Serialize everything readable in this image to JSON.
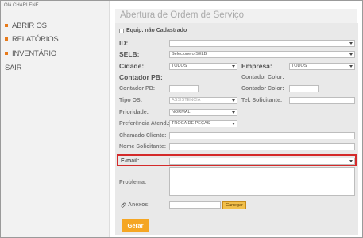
{
  "sidebar": {
    "user": "Olá CHARLENE",
    "items": [
      {
        "label": "ABRIR OS"
      },
      {
        "label": "RELATÓRIOS"
      },
      {
        "label": "INVENTÁRIO"
      },
      {
        "label": "SAIR"
      }
    ]
  },
  "form": {
    "title": "Abertura de Ordem de Serviço",
    "equip_checkbox_label": "Equip. não Cadastrado",
    "id_label": "ID:",
    "selb_label": "SELB:",
    "selb_value": "Selecione o SELB",
    "cidade_label": "Cidade:",
    "cidade_value": "TODOS",
    "empresa_label": "Empresa:",
    "empresa_value": "TODOS",
    "contador_pb_label": "Contador PB:",
    "contador_color_label": "Contador Color:",
    "contador_pb_small_label": "Contador PB:",
    "contador_color_small_label": "Contador Color:",
    "tipo_os_label": "Tipo OS:",
    "tipo_os_value": "ASSISTÊNCIA",
    "tel_solicitante_label": "Tel. Solicitante:",
    "prioridade_label": "Prioridade:",
    "prioridade_value": "NORMAL",
    "preferencia_label": "Preferência Atend.:",
    "preferencia_value": "TROCA DE PEÇAS",
    "chamado_cliente_label": "Chamado Cliente:",
    "nome_solicitante_label": "Nome Solicitante:",
    "email_label": "E-mail:",
    "problema_label": "Problema:",
    "anexos_label": "Anexos:",
    "upload_label": "Carregar",
    "submit_label": "Gerar"
  },
  "colors": {
    "accent": "#f5a623",
    "highlight": "#d42a2a",
    "bullet": "#e77a1a"
  },
  "icons": [
    "checkbox-icon",
    "paperclip-icon",
    "chevron-down-icon"
  ]
}
